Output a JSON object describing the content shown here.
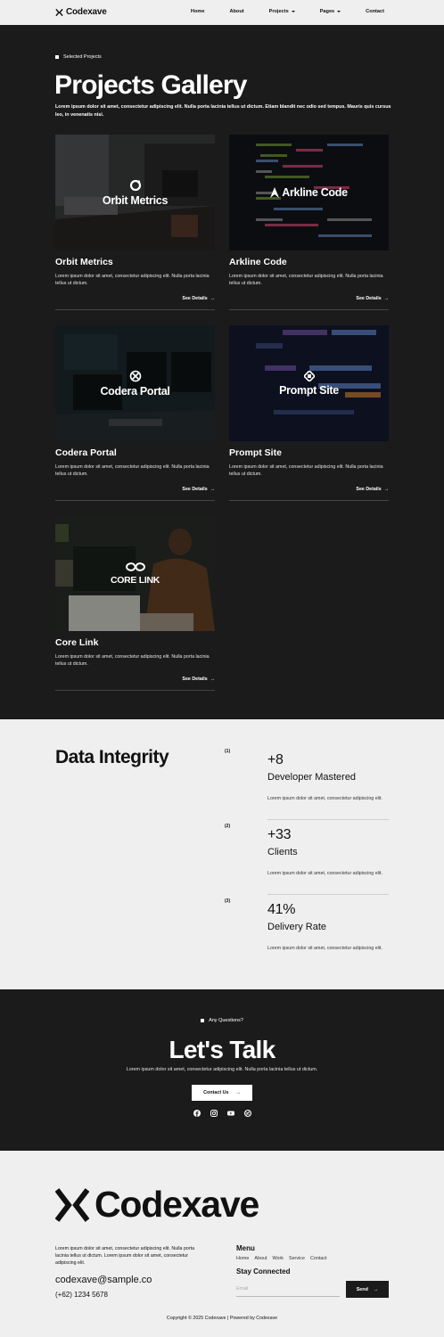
{
  "nav": {
    "logo": "Codexave",
    "links": [
      "Home",
      "About",
      "Projects",
      "Pages",
      "Contact"
    ]
  },
  "hero": {
    "eyebrow": "Selected Projects",
    "title": "Projects Gallery",
    "description": "Lorem ipsum dolor sit amet, consectetur adipiscing elit. Nulla porta lacinia tellus ut dictum. Etiam blandit nec odio sed tempus. Mauris quis cursus leo, in venenatis nisi."
  },
  "projects": [
    {
      "name": "Orbit Metrics",
      "brand": "Orbit Metrics",
      "icon": "orbit-icon",
      "description": "Lorem ipsum dolor sit amet, consectetur adipiscing elit. Nulla porta lacinia tellus ut dictum.",
      "link": "See Details"
    },
    {
      "name": "Arkline Code",
      "brand": "Arkline Code",
      "icon": "arkline-icon",
      "description": "Lorem ipsum dolor sit amet, consectetur adipiscing elit. Nulla porta lacinia tellus ut dictum.",
      "link": "See Details"
    },
    {
      "name": "Codera Portal",
      "brand": "Codera Portal",
      "icon": "codera-icon",
      "description": "Lorem ipsum dolor sit amet, consectetur adipiscing elit. Nulla porta lacinia tellus ut dictum.",
      "link": "See Details"
    },
    {
      "name": "Prompt Site",
      "brand": "Prompt Site",
      "icon": "prompt-icon",
      "description": "Lorem ipsum dolor sit amet, consectetur adipiscing elit. Nulla porta lacinia tellus ut dictum.",
      "link": "See Details"
    },
    {
      "name": "Core Link",
      "brand": "CORE LINK",
      "icon": "corelink-icon",
      "description": "Lorem ipsum dolor sit amet, consectetur adipiscing elit. Nulla porta lacinia tellus ut dictum.",
      "link": "See Details"
    }
  ],
  "stats": {
    "title": "Data Integrity",
    "items": [
      {
        "num": "(1)",
        "value": "+8",
        "label": "Developer Mastered",
        "description": "Lorem ipsum dolor sit amet, consectetur adipiscing elit."
      },
      {
        "num": "(2)",
        "value": "+33",
        "label": "Clients",
        "description": "Lorem ipsum dolor sit amet, consectetur adipiscing elit."
      },
      {
        "num": "(3)",
        "value": "41%",
        "label": "Delivery Rate",
        "description": "Lorem ipsum dolor sit amet, consectetur adipiscing elit."
      }
    ]
  },
  "cta": {
    "eyebrow": "Any Questions?",
    "title": "Let's Talk",
    "description": "Lorem ipsum dolor sit amet, consectetur adipiscing elit. Nulla porta lacinia tellus ut dictum.",
    "button": "Contact Us",
    "socials": [
      "facebook-icon",
      "instagram-icon",
      "youtube-icon",
      "dribbble-icon"
    ]
  },
  "footer": {
    "logo": "Codexave",
    "description": "Lorem ipsum dolor sit amet, consectetur adipiscing elit. Nulla porta lacinia tellus ut dictum. Lorem ipsum dolor sit amet, consectetur adipiscing elit.",
    "email": "codexave@sample.co",
    "phone": "(+62) 1234 5678",
    "menu_title": "Menu",
    "menu": [
      "Home",
      "About",
      "Work",
      "Service",
      "Contact"
    ],
    "stay_title": "Stay Connected",
    "email_placeholder": "Email",
    "send": "Send",
    "copyright": "Copyright © 2025 Codexave | Powered by Codexave"
  },
  "colors": {
    "dark": "#1b1b1b",
    "light": "#efefef",
    "accent": "#ffffff"
  }
}
